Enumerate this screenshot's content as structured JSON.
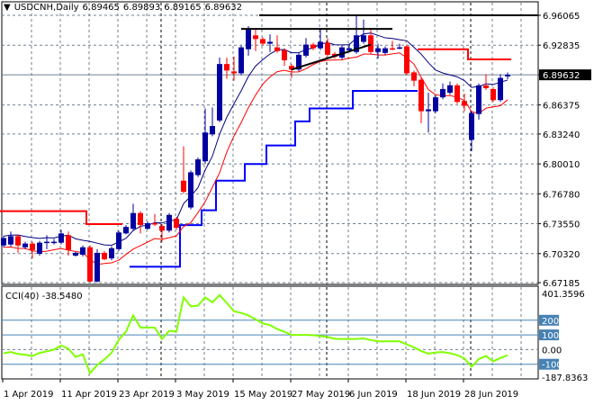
{
  "header": {
    "symbol_tf": "USDCNH,Daily",
    "open": "6.89465",
    "high": "6.89893",
    "low": "6.89165",
    "close": "6.89632",
    "menu_icon": "triangle-down-icon"
  },
  "colors": {
    "bull": "#0000a0",
    "bear": "#ff0000",
    "ma_high": "#000080",
    "ma_low": "#ff0000",
    "stop_up": "#0000ff",
    "stop_down": "#ff0000",
    "cci": "#80ff00",
    "level": "#4682b4",
    "current_price_bg": "#000000"
  },
  "chart_data": [
    {
      "type": "candlestick",
      "title": "USDCNH,Daily",
      "ylim": [
        6.67185,
        6.96065
      ],
      "y_ticks": [
        "6.96065",
        "6.92835",
        "6.89632",
        "6.86375",
        "6.83240",
        "6.80010",
        "6.76780",
        "6.73550",
        "6.70320",
        "6.67185"
      ],
      "current_price": "6.89632",
      "x_labels": [
        {
          "index": 0,
          "label": "1 Apr 2019"
        },
        {
          "index": 8,
          "label": "11 Apr 2019"
        },
        {
          "index": 16,
          "label": "23 Apr 2019"
        },
        {
          "index": 24,
          "label": "3 May 2019"
        },
        {
          "index": 32,
          "label": "15 May 2019"
        },
        {
          "index": 40,
          "label": "27 May 2019"
        },
        {
          "index": 48,
          "label": "6 Jun 2019"
        },
        {
          "index": 56,
          "label": "18 Jun 2019"
        },
        {
          "index": 64,
          "label": "28 Jun 2019"
        }
      ],
      "month_separators": [
        22,
        45,
        65
      ],
      "ohlc": [
        [
          6.712,
          6.722,
          6.71,
          6.72
        ],
        [
          6.713,
          6.727,
          6.711,
          6.722
        ],
        [
          6.722,
          6.724,
          6.704,
          6.712
        ],
        [
          6.71,
          6.716,
          6.708,
          6.714
        ],
        [
          6.714,
          6.716,
          6.698,
          6.707
        ],
        [
          6.703,
          6.717,
          6.701,
          6.715
        ],
        [
          6.715,
          6.723,
          6.708,
          6.716
        ],
        [
          6.715,
          6.719,
          6.713,
          6.716
        ],
        [
          6.715,
          6.729,
          6.713,
          6.725
        ],
        [
          6.723,
          6.727,
          6.701,
          6.707
        ],
        [
          6.701,
          6.705,
          6.7,
          6.704
        ],
        [
          6.702,
          6.712,
          6.7,
          6.71
        ],
        [
          6.71,
          6.712,
          6.672,
          6.673
        ],
        [
          6.673,
          6.708,
          6.672,
          6.704
        ],
        [
          6.704,
          6.706,
          6.696,
          6.697
        ],
        [
          6.698,
          6.711,
          6.696,
          6.709
        ],
        [
          6.708,
          6.728,
          6.706,
          6.726
        ],
        [
          6.725,
          6.734,
          6.724,
          6.732
        ],
        [
          6.73,
          6.757,
          6.728,
          6.747
        ],
        [
          6.747,
          6.749,
          6.725,
          6.734
        ],
        [
          6.73,
          6.738,
          6.729,
          6.736
        ],
        [
          6.736,
          6.746,
          6.733,
          6.735
        ],
        [
          6.733,
          6.735,
          6.716,
          6.728
        ],
        [
          6.728,
          6.747,
          6.726,
          6.745
        ],
        [
          6.741,
          6.743,
          6.729,
          6.731
        ],
        [
          6.782,
          6.819,
          6.768,
          6.77
        ],
        [
          6.753,
          6.793,
          6.751,
          6.791
        ],
        [
          6.788,
          6.807,
          6.786,
          6.805
        ],
        [
          6.803,
          6.86,
          6.8,
          6.834
        ],
        [
          6.832,
          6.861,
          6.83,
          6.841
        ],
        [
          6.847,
          6.915,
          6.845,
          6.908
        ],
        [
          6.908,
          6.915,
          6.892,
          6.901
        ],
        [
          6.9,
          6.916,
          6.89,
          6.898
        ],
        [
          6.898,
          6.928,
          6.896,
          6.926
        ],
        [
          6.924,
          6.949,
          6.917,
          6.945
        ],
        [
          6.939,
          6.945,
          6.922,
          6.935
        ],
        [
          6.935,
          6.937,
          6.928,
          6.93
        ],
        [
          6.93,
          6.94,
          6.921,
          6.932
        ],
        [
          6.926,
          6.939,
          6.92,
          6.922
        ],
        [
          6.923,
          6.925,
          6.906,
          6.912
        ],
        [
          6.906,
          6.908,
          6.893,
          6.902
        ],
        [
          6.902,
          6.92,
          6.9,
          6.918
        ],
        [
          6.917,
          6.936,
          6.915,
          6.929
        ],
        [
          6.929,
          6.931,
          6.923,
          6.925
        ],
        [
          6.925,
          6.945,
          6.923,
          6.932
        ],
        [
          6.931,
          6.936,
          6.916,
          6.918
        ],
        [
          6.919,
          6.921,
          6.914,
          6.916
        ],
        [
          6.915,
          6.928,
          6.913,
          6.926
        ],
        [
          6.923,
          6.93,
          6.921,
          6.925
        ],
        [
          6.921,
          6.961,
          6.919,
          6.939
        ],
        [
          6.932,
          6.956,
          6.93,
          6.939
        ],
        [
          6.939,
          6.945,
          6.919,
          6.921
        ],
        [
          6.921,
          6.93,
          6.914,
          6.925
        ],
        [
          6.92,
          6.927,
          6.918,
          6.925
        ],
        [
          6.925,
          6.933,
          6.923,
          6.924
        ],
        [
          6.925,
          6.93,
          6.924,
          6.926
        ],
        [
          6.927,
          6.929,
          6.896,
          6.898
        ],
        [
          6.899,
          6.901,
          6.884,
          6.89
        ],
        [
          6.891,
          6.893,
          6.844,
          6.857
        ],
        [
          6.857,
          6.877,
          6.834,
          6.859
        ],
        [
          6.857,
          6.874,
          6.855,
          6.872
        ],
        [
          6.872,
          6.887,
          6.87,
          6.881
        ],
        [
          6.877,
          6.889,
          6.875,
          6.885
        ],
        [
          6.885,
          6.887,
          6.865,
          6.867
        ],
        [
          6.868,
          6.876,
          6.857,
          6.863
        ],
        [
          6.826,
          6.857,
          6.814,
          6.855
        ],
        [
          6.854,
          6.887,
          6.848,
          6.885
        ],
        [
          6.885,
          6.897,
          6.88,
          6.882
        ],
        [
          6.881,
          6.883,
          6.867,
          6.869
        ],
        [
          6.869,
          6.897,
          6.867,
          6.893
        ],
        [
          6.89465,
          6.89893,
          6.89165,
          6.89632
        ]
      ],
      "stop_up": [
        {
          "from": 18,
          "to": 24,
          "value": 6.689
        },
        {
          "from": 25,
          "to": 27,
          "value": 6.734
        },
        {
          "from": 28,
          "to": 29,
          "value": 6.75
        },
        {
          "from": 30,
          "to": 33,
          "value": 6.782
        },
        {
          "from": 34,
          "to": 36,
          "value": 6.8
        },
        {
          "from": 37,
          "to": 40,
          "value": 6.82
        },
        {
          "from": 41,
          "to": 42,
          "value": 6.846
        },
        {
          "from": 43,
          "to": 48,
          "value": 6.86
        },
        {
          "from": 49,
          "to": 57,
          "value": 6.879
        }
      ],
      "stop_down": [
        {
          "from": 0,
          "to": 11,
          "value": 6.749
        },
        {
          "from": 12,
          "to": 16,
          "value": 6.735
        },
        {
          "from": 58,
          "to": 64,
          "value": 6.924
        },
        {
          "from": 65,
          "to": 70,
          "value": 6.913
        }
      ],
      "trendlines": [
        {
          "from": 33,
          "to": 54,
          "y1": 6.946,
          "y2": 6.946
        },
        {
          "from": 40,
          "to": 51,
          "y1": 6.902,
          "y2": 6.929
        }
      ]
    },
    {
      "type": "line",
      "title": "CCI(40)",
      "current_value": "-38.5480",
      "ylim": [
        -187.8363,
        401.3596
      ],
      "y_ticks": [
        "401.3596",
        "200",
        "100",
        "0.00",
        "-100",
        "-187.8363"
      ],
      "levels": [
        200,
        100,
        -100
      ],
      "values": [
        -25,
        -17,
        -30,
        -35,
        -44,
        -23,
        -12,
        0,
        28,
        5,
        -50,
        -32,
        -161,
        -106,
        -67,
        -22,
        67,
        122,
        233,
        150,
        150,
        150,
        72,
        128,
        122,
        356,
        294,
        300,
        356,
        322,
        372,
        317,
        261,
        250,
        233,
        206,
        178,
        167,
        139,
        122,
        100,
        100,
        100,
        98,
        92,
        85,
        74,
        72,
        72,
        72,
        76,
        65,
        56,
        56,
        56,
        56,
        35,
        15,
        -10,
        -28,
        -20,
        -17,
        -25,
        -38,
        -60,
        -117,
        -65,
        -44,
        -80,
        -58,
        -38.548
      ]
    }
  ]
}
